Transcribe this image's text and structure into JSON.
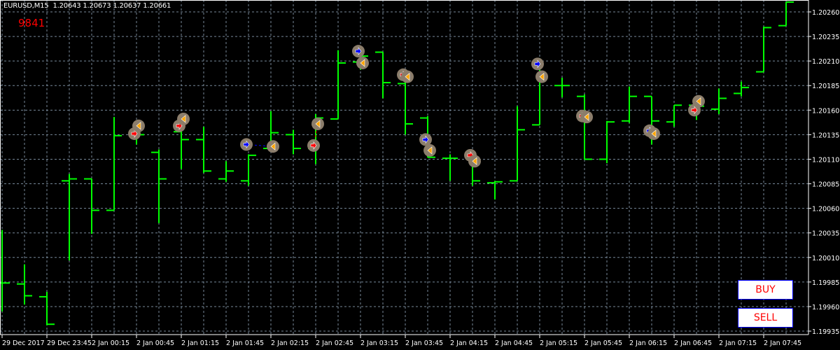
{
  "header": {
    "symbol": "EURUSD,M15",
    "quote": "1.20643 1.20673 1.20637 1.20661"
  },
  "counter": "9841",
  "buttons": {
    "buy": "BUY",
    "sell": "SELL"
  },
  "colors": {
    "background": "#000000",
    "bars": "#00ff00",
    "grid": "#778899",
    "axis": "#ffffff",
    "text": "#ffffff",
    "counter": "#ff0000",
    "button_text": "#ff0000",
    "button_border": "#0000ff",
    "marker_bg": "#8b7d6b",
    "buy_arrow": "#0000ff",
    "sell_arrow": "#ff0000",
    "close_marker": "#ffa500"
  },
  "chart_data": {
    "type": "ohlc",
    "ylim": [
      1.19925,
      1.20272
    ],
    "y_ticks": [
      "1.20260",
      "1.20235",
      "1.20210",
      "1.20185",
      "1.20160",
      "1.20135",
      "1.20110",
      "1.20085",
      "1.20060",
      "1.20035",
      "1.20010",
      "1.19985",
      "1.19960",
      "1.19935"
    ],
    "x_ticks": [
      {
        "bar": 0,
        "label": "29 Dec 2017"
      },
      {
        "bar": 2,
        "label": "29 Dec 23:45"
      },
      {
        "bar": 4,
        "label": "2 Jan 00:15"
      },
      {
        "bar": 6,
        "label": "2 Jan 00:45"
      },
      {
        "bar": 8,
        "label": "2 Jan 01:15"
      },
      {
        "bar": 10,
        "label": "2 Jan 01:45"
      },
      {
        "bar": 12,
        "label": "2 Jan 02:15"
      },
      {
        "bar": 14,
        "label": "2 Jan 02:45"
      },
      {
        "bar": 16,
        "label": "2 Jan 03:15"
      },
      {
        "bar": 18,
        "label": "2 Jan 03:45"
      },
      {
        "bar": 20,
        "label": "2 Jan 04:15"
      },
      {
        "bar": 22,
        "label": "2 Jan 04:45"
      },
      {
        "bar": 24,
        "label": "2 Jan 05:15"
      },
      {
        "bar": 26,
        "label": "2 Jan 05:45"
      },
      {
        "bar": 28,
        "label": "2 Jan 06:15"
      },
      {
        "bar": 30,
        "label": "2 Jan 06:45"
      },
      {
        "bar": 32,
        "label": "2 Jan 07:15"
      },
      {
        "bar": 34,
        "label": "2 Jan 07:45"
      }
    ],
    "bars": [
      [
        1.19984,
        1.20038,
        1.19955,
        1.19984
      ],
      [
        1.19983,
        1.20003,
        1.19962,
        1.19971
      ],
      [
        1.1997,
        1.19975,
        1.19941,
        1.19942
      ],
      [
        1.20088,
        1.20095,
        1.20007,
        1.2009
      ],
      [
        1.2009,
        1.2009,
        1.20034,
        1.20058
      ],
      [
        1.20058,
        1.20153,
        1.20058,
        1.20134
      ],
      [
        1.20134,
        1.2014,
        1.20125,
        1.20135
      ],
      [
        1.20117,
        1.2012,
        1.20045,
        1.2009
      ],
      [
        1.20138,
        1.20149,
        1.201,
        1.2013
      ],
      [
        1.2013,
        1.20143,
        1.20096,
        1.20098
      ],
      [
        1.2009,
        1.20108,
        1.20087,
        1.20098
      ],
      [
        1.20088,
        1.20115,
        1.20083,
        1.20114
      ],
      [
        1.20121,
        1.20159,
        1.2012,
        1.20137
      ],
      [
        1.20135,
        1.2014,
        1.20115,
        1.20121
      ],
      [
        1.20121,
        1.20156,
        1.20105,
        1.20152
      ],
      [
        1.20151,
        1.20221,
        1.20151,
        1.20208
      ],
      [
        1.20209,
        1.20219,
        1.20201,
        1.20215
      ],
      [
        1.20219,
        1.20219,
        1.20172,
        1.20188
      ],
      [
        1.20187,
        1.20201,
        1.20135,
        1.20146
      ],
      [
        1.20152,
        1.20154,
        1.20112,
        1.20112
      ],
      [
        1.20111,
        1.20115,
        1.20088,
        1.20111
      ],
      [
        1.20112,
        1.20117,
        1.20083,
        1.20088
      ],
      [
        1.20086,
        1.20088,
        1.20069,
        1.20087
      ],
      [
        1.20088,
        1.20164,
        1.20088,
        1.2014
      ],
      [
        1.20145,
        1.20213,
        1.20145,
        1.20194
      ],
      [
        1.20185,
        1.20193,
        1.20173,
        1.20185
      ],
      [
        1.20174,
        1.20176,
        1.2011,
        1.2011
      ],
      [
        1.2011,
        1.20149,
        1.20106,
        1.20148
      ],
      [
        1.20149,
        1.20184,
        1.20147,
        1.20174
      ],
      [
        1.20174,
        1.20174,
        1.20125,
        1.20149
      ],
      [
        1.20148,
        1.20165,
        1.20143,
        1.20165
      ],
      [
        1.20165,
        1.20174,
        1.2015,
        1.20164
      ],
      [
        1.20161,
        1.20182,
        1.20156,
        1.20172
      ],
      [
        1.20177,
        1.20189,
        1.20174,
        1.20183
      ],
      [
        1.20199,
        1.20245,
        1.20199,
        1.20244
      ],
      [
        1.20246,
        1.2027,
        1.20246,
        1.2027
      ]
    ],
    "trades": [
      {
        "bar": 6,
        "open": 1.20136,
        "close": 1.20144,
        "side": "sell"
      },
      {
        "bar": 8,
        "open": 1.20144,
        "close": 1.20151,
        "side": "sell"
      },
      {
        "bar": 11,
        "open": 1.20125,
        "close": 1.20123,
        "side": "buy",
        "close_bar": 12
      },
      {
        "bar": 14,
        "open": 1.20124,
        "close": 1.20146,
        "side": "sell"
      },
      {
        "bar": 16,
        "open": 1.2022,
        "close": 1.20208,
        "side": "buy"
      },
      {
        "bar": 18,
        "open": 1.20196,
        "close": 1.20194,
        "side": "sell"
      },
      {
        "bar": 19,
        "open": 1.2013,
        "close": 1.20119,
        "side": "buy"
      },
      {
        "bar": 21,
        "open": 1.20114,
        "close": 1.20108,
        "side": "sell"
      },
      {
        "bar": 24,
        "open": 1.20207,
        "close": 1.20194,
        "side": "buy"
      },
      {
        "bar": 26,
        "open": 1.20154,
        "close": 1.20153,
        "side": "sell"
      },
      {
        "bar": 29,
        "open": 1.20139,
        "close": 1.20136,
        "side": "buy"
      },
      {
        "bar": 31,
        "open": 1.2016,
        "close": 1.20169,
        "side": "sell"
      }
    ]
  }
}
